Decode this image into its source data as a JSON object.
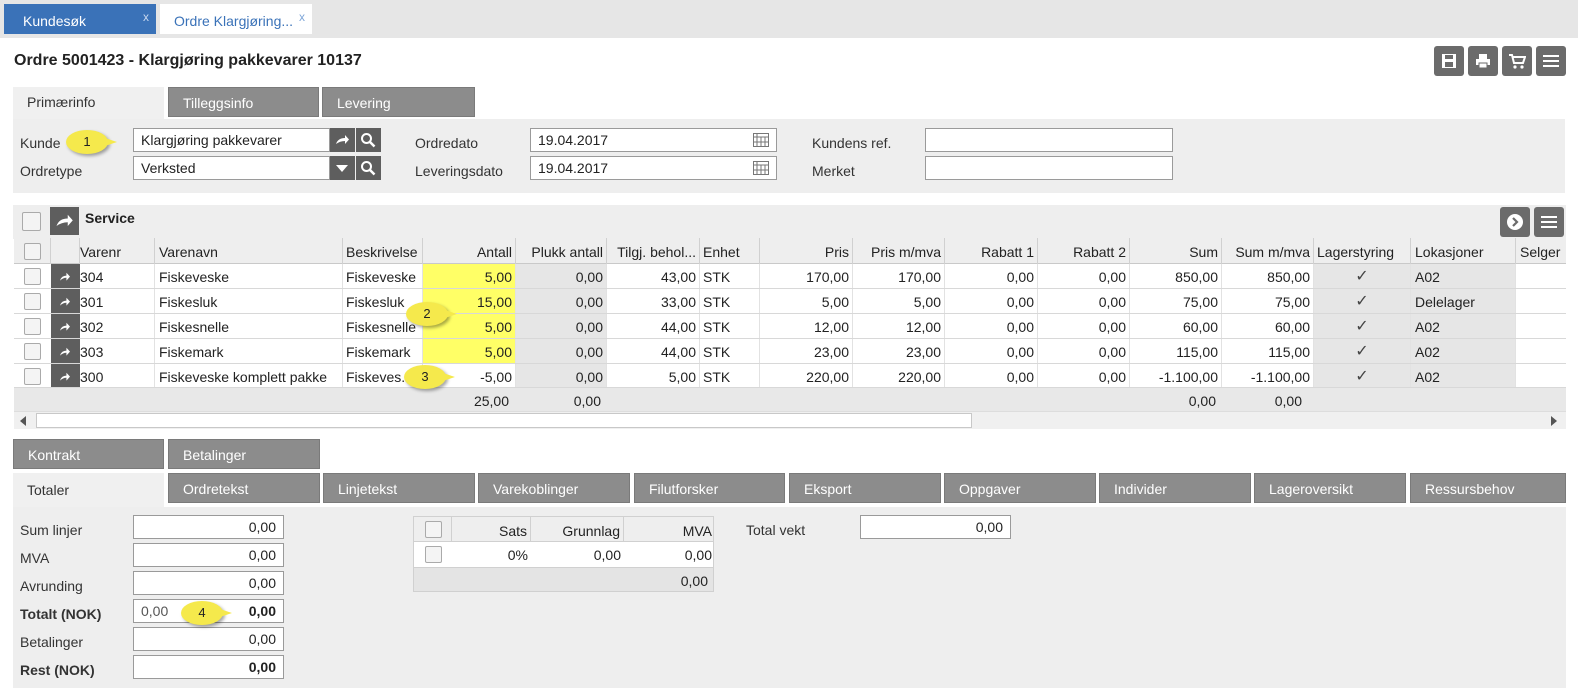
{
  "tabs": [
    {
      "label": "Kundesøk",
      "close": "x"
    },
    {
      "label": "Ordre Klargjøring...",
      "close": "x"
    }
  ],
  "page_title": "Ordre 5001423 - Klargjøring pakkevarer 10137",
  "form_tabs": [
    "Primærinfo",
    "Tilleggsinfo",
    "Levering"
  ],
  "form": {
    "kunde_label": "Kunde",
    "kunde_value": "Klargjøring pakkevarer",
    "ordretype_label": "Ordretype",
    "ordretype_value": "Verksted",
    "ordredato_label": "Ordredato",
    "ordredato_value": "19.04.2017",
    "leveringsdato_label": "Leveringsdato",
    "leveringsdato_value": "19.04.2017",
    "kundens_ref_label": "Kundens ref.",
    "kundens_ref_value": "",
    "merket_label": "Merket",
    "merket_value": ""
  },
  "service": {
    "title": "Service",
    "columns": [
      "Varenr",
      "Varenavn",
      "Beskrivelse",
      "Antall",
      "Plukk antall",
      "Tilgj. behol...",
      "Enhet",
      "Pris",
      "Pris m/mva",
      "Rabatt 1",
      "Rabatt 2",
      "Sum",
      "Sum m/mva",
      "Lagerstyring",
      "Lokasjoner",
      "Selger"
    ],
    "rows": [
      {
        "varenr": "304",
        "varenavn": "Fiskeveske",
        "beskrivelse": "Fiskeveske",
        "antall": "5,00",
        "plukk": "0,00",
        "tilgj": "43,00",
        "enhet": "STK",
        "pris": "170,00",
        "prismva": "170,00",
        "rab1": "0,00",
        "rab2": "0,00",
        "sum": "850,00",
        "summva": "850,00",
        "lager": "✓",
        "lok": "A02"
      },
      {
        "varenr": "301",
        "varenavn": "Fiskesluk",
        "beskrivelse": "Fiskesluk",
        "antall": "15,00",
        "plukk": "0,00",
        "tilgj": "33,00",
        "enhet": "STK",
        "pris": "5,00",
        "prismva": "5,00",
        "rab1": "0,00",
        "rab2": "0,00",
        "sum": "75,00",
        "summva": "75,00",
        "lager": "✓",
        "lok": "Delelager"
      },
      {
        "varenr": "302",
        "varenavn": "Fiskesnelle",
        "beskrivelse": "Fiskesnelle",
        "antall": "5,00",
        "plukk": "0,00",
        "tilgj": "44,00",
        "enhet": "STK",
        "pris": "12,00",
        "prismva": "12,00",
        "rab1": "0,00",
        "rab2": "0,00",
        "sum": "60,00",
        "summva": "60,00",
        "lager": "✓",
        "lok": "A02"
      },
      {
        "varenr": "303",
        "varenavn": "Fiskemark",
        "beskrivelse": "Fiskemark",
        "antall": "5,00",
        "plukk": "0,00",
        "tilgj": "44,00",
        "enhet": "STK",
        "pris": "23,00",
        "prismva": "23,00",
        "rab1": "0,00",
        "rab2": "0,00",
        "sum": "115,00",
        "summva": "115,00",
        "lager": "✓",
        "lok": "A02"
      },
      {
        "varenr": "300",
        "varenavn": "Fiskeveske komplett pakke",
        "beskrivelse": "Fiskeves...",
        "antall": "-5,00",
        "plukk": "0,00",
        "tilgj": "5,00",
        "enhet": "STK",
        "pris": "220,00",
        "prismva": "220,00",
        "rab1": "0,00",
        "rab2": "0,00",
        "sum": "-1.100,00",
        "summva": "-1.100,00",
        "lager": "✓",
        "lok": "A02"
      }
    ],
    "totals": {
      "antall": "25,00",
      "plukk": "0,00",
      "sum": "0,00",
      "summva": "0,00"
    }
  },
  "bottom_tabs_row1": [
    "Kontrakt",
    "Betalinger"
  ],
  "bottom_tabs_row2": [
    "Totaler",
    "Ordretekst",
    "Linjetekst",
    "Varekoblinger",
    "Filutforsker",
    "Eksport",
    "Oppgaver",
    "Individer",
    "Lageroversikt",
    "Ressursbehov"
  ],
  "totaler": {
    "sum_linjer_label": "Sum linjer",
    "sum_linjer": "0,00",
    "mva_label": "MVA",
    "mva": "0,00",
    "avrunding_label": "Avrunding",
    "avrunding": "0,00",
    "totalt_label": "Totalt (NOK)",
    "totalt_left": "0,00",
    "totalt": "0,00",
    "betalinger_label": "Betalinger",
    "betalinger": "0,00",
    "rest_label": "Rest (NOK)",
    "rest": "0,00",
    "total_vekt_label": "Total vekt",
    "total_vekt": "0,00"
  },
  "mva_table": {
    "columns": [
      "Sats",
      "Grunnlag",
      "MVA"
    ],
    "row": {
      "sats": "0%",
      "grunnlag": "0,00",
      "mva": "0,00"
    },
    "total": "0,00"
  },
  "badges": [
    "1",
    "2",
    "3",
    "4"
  ],
  "colors": {
    "tab_blue": "#3a72b8",
    "highlight_yellow": "#ffff66",
    "badge_yellow": "#f5e94c",
    "button_gray": "#5e5e5e"
  }
}
